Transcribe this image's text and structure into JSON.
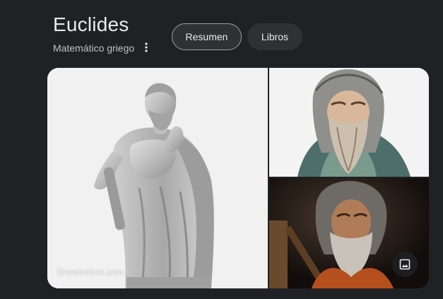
{
  "entity": {
    "title": "Euclides",
    "subtitle": "Matemático griego",
    "more_icon": "more-vert-icon"
  },
  "chips": [
    {
      "label": "Resumen",
      "selected": true
    },
    {
      "label": "Libros",
      "selected": false
    }
  ],
  "gallery": {
    "main_watermark": "Dreamstime.com",
    "badge_icon": "image-icon"
  },
  "colors": {
    "background": "#202124",
    "text_primary": "#e8eaed",
    "text_secondary": "#bdc1c6",
    "chip_background": "#303134",
    "chip_selected_border": "#9aa0a6"
  }
}
